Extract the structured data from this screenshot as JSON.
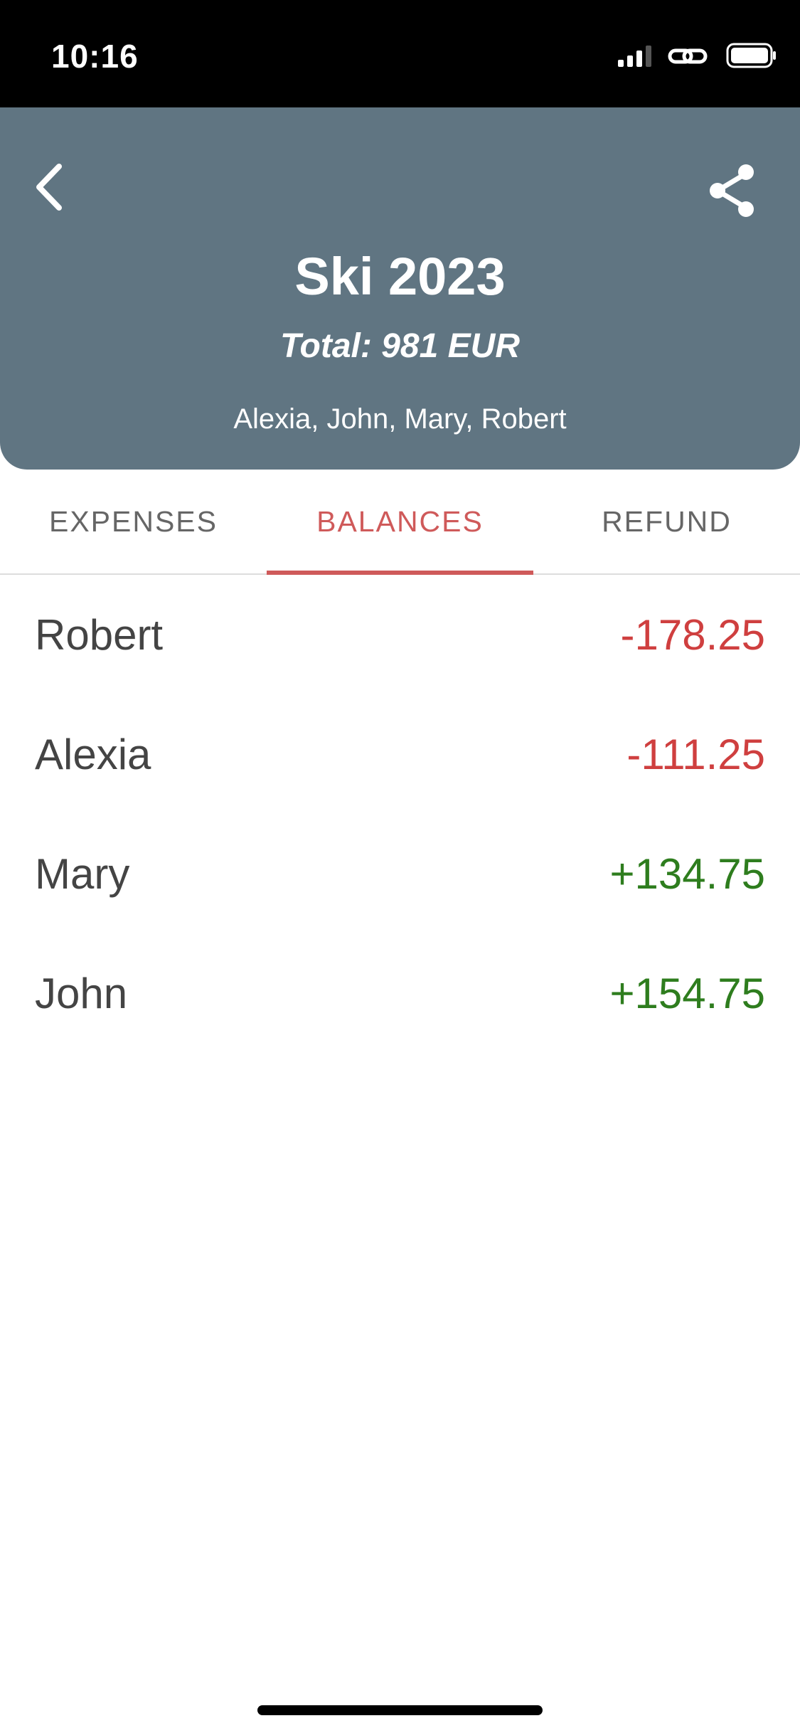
{
  "status_bar": {
    "time": "10:16",
    "icons": [
      "signal-icon",
      "link-icon",
      "battery-icon"
    ]
  },
  "header": {
    "title": "Ski 2023",
    "total": "Total: 981 EUR",
    "participants": "Alexia, John, Mary, Robert",
    "background_color": "#607582",
    "back_icon": "chevron-left-icon",
    "share_icon": "share-icon"
  },
  "tabs": [
    {
      "label": "EXPENSES",
      "active": false
    },
    {
      "label": "BALANCES",
      "active": true
    },
    {
      "label": "REFUND",
      "active": false
    }
  ],
  "balances": [
    {
      "name": "Robert",
      "amount": "-178.25",
      "color": "#cf3f3f"
    },
    {
      "name": "Alexia",
      "amount": "-111.25",
      "color": "#cf3f3f"
    },
    {
      "name": "Mary",
      "amount": "+134.75",
      "color": "#2e7d1e"
    },
    {
      "name": "John",
      "amount": "+154.75",
      "color": "#2e7d1e"
    }
  ],
  "colors": {
    "accent": "#cf5a5a",
    "negative": "#cf3f3f",
    "positive": "#2e7d1e"
  }
}
